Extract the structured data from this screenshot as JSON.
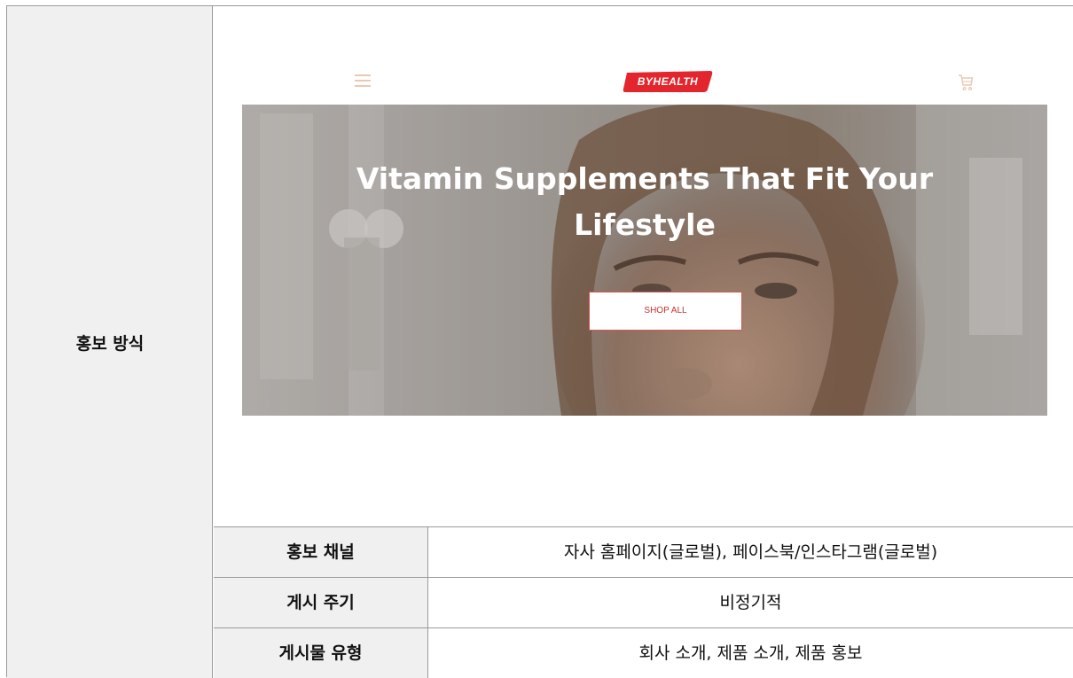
{
  "left_label": "홍보 방식",
  "screenshot": {
    "logo_text": "BYHEALTH",
    "hero_title_line1": "Vitamin Supplements That Fit Your",
    "hero_title_line2": "Lifestyle",
    "cta_label": "SHOP ALL",
    "icons": [
      "hamburger-menu-icon",
      "cart-icon"
    ],
    "colors": {
      "brand_red": "#e3262e",
      "menu_icon": "#e9c9b2",
      "cta_border": "#d9534f"
    }
  },
  "rows": [
    {
      "key": "홍보 채널",
      "value": "자사 홈페이지(글로벌), 페이스북/인스타그램(글로벌)"
    },
    {
      "key": "게시 주기",
      "value": "비정기적"
    },
    {
      "key": "게시물 유형",
      "value": "회사 소개, 제품 소개, 제품 홍보"
    }
  ]
}
